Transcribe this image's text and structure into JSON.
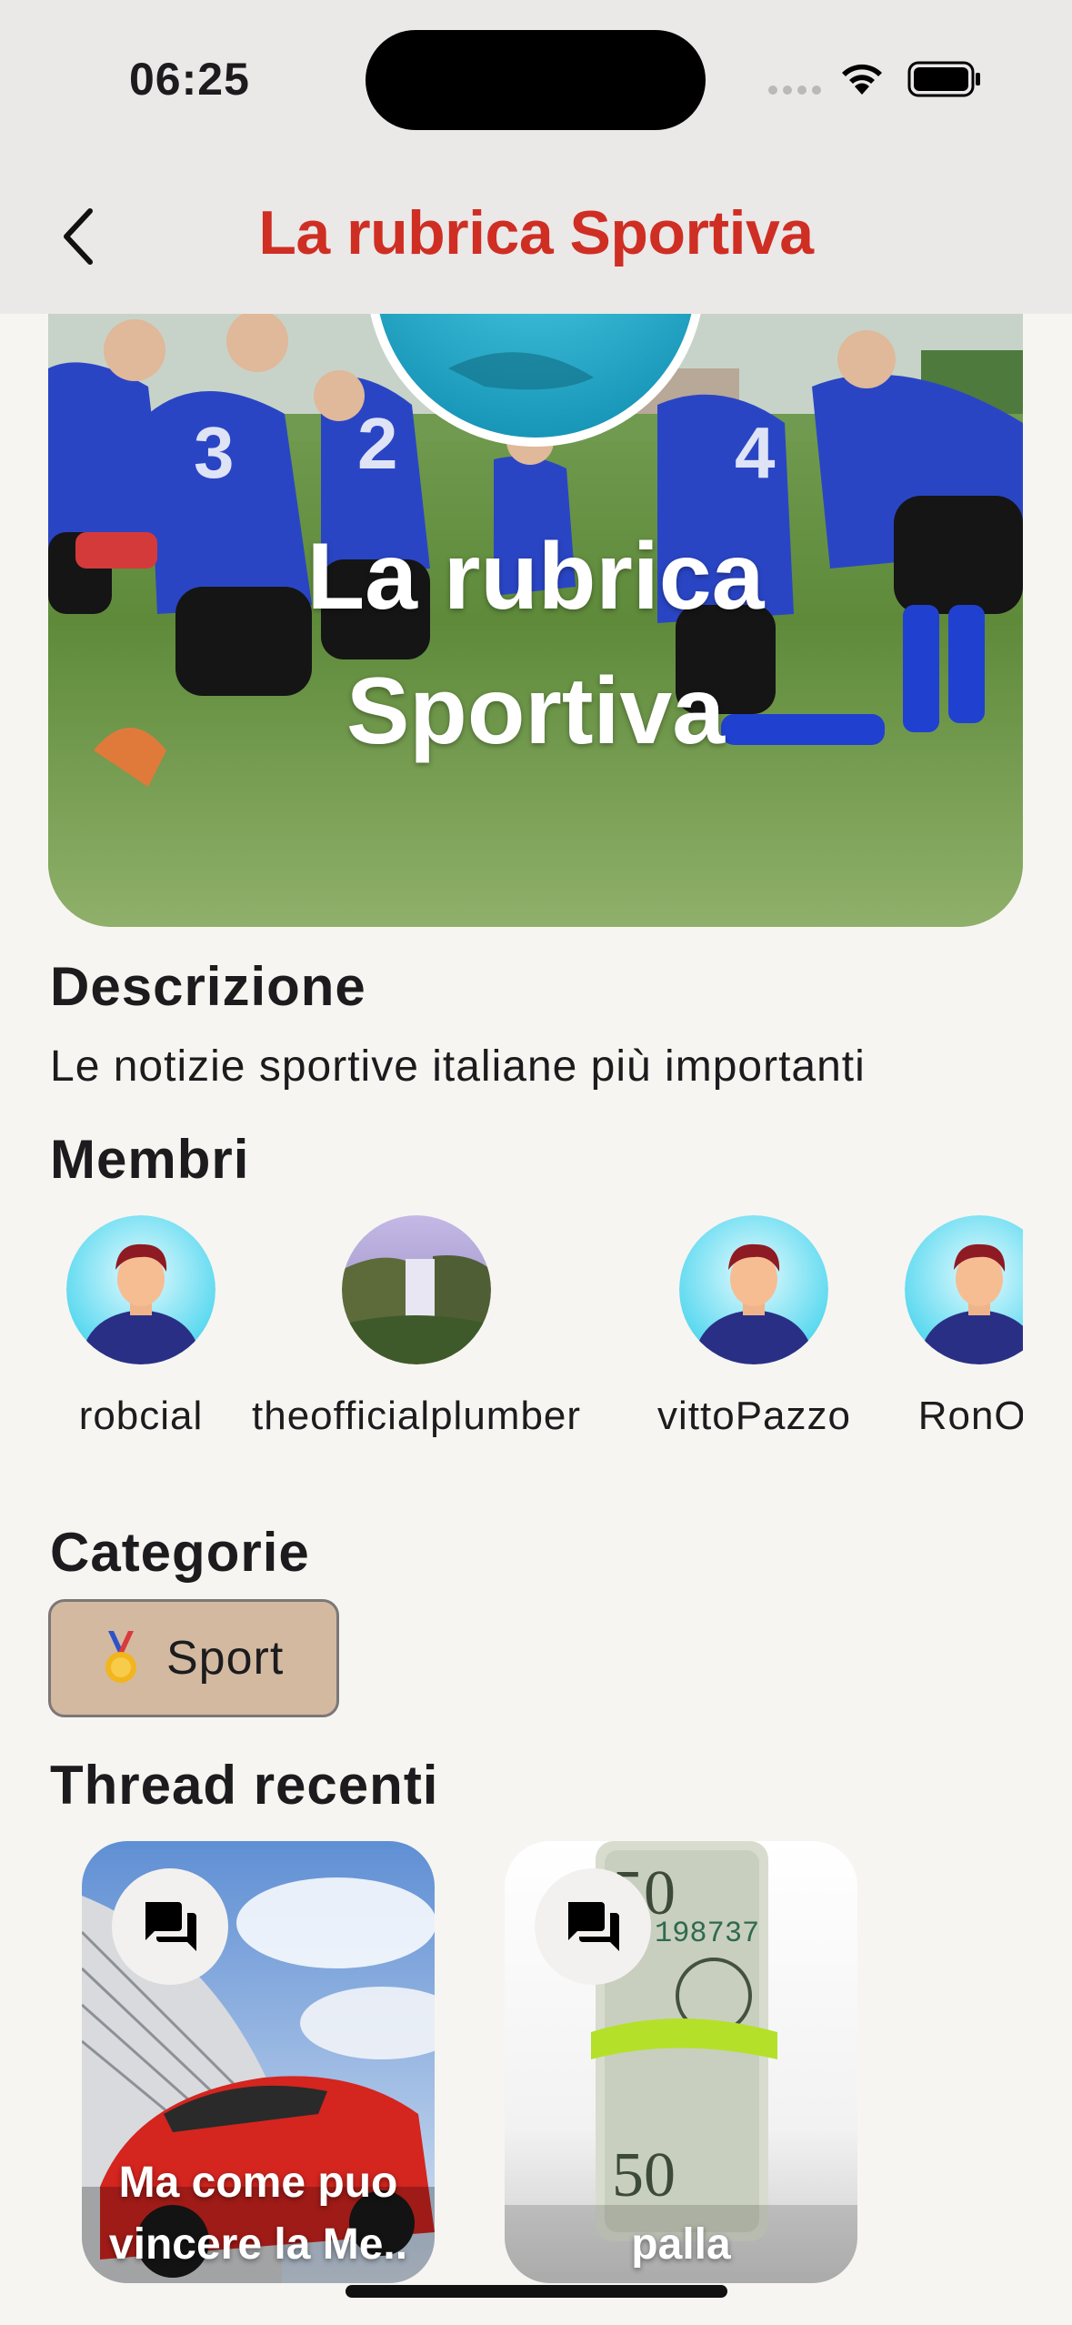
{
  "status_bar": {
    "time": "06:25"
  },
  "nav": {
    "title": "La rubrica Sportiva"
  },
  "banner": {
    "title_line1": "La rubrica",
    "title_line2": "Sportiva"
  },
  "description": {
    "heading": "Descrizione",
    "text": "Le notizie sportive italiane più importanti"
  },
  "members": {
    "heading": "Membri",
    "items": [
      {
        "name": "robcial",
        "avatar": "person-avatar"
      },
      {
        "name": "theofficialplumber",
        "avatar": "waterfall-photo"
      },
      {
        "name": "vittoPazzo",
        "avatar": "person-avatar"
      },
      {
        "name": "RonOr",
        "avatar": "person-avatar"
      }
    ]
  },
  "categories": {
    "heading": "Categorie",
    "items": [
      {
        "icon": "medal-icon",
        "label": "Sport"
      }
    ]
  },
  "threads": {
    "heading": "Thread recenti",
    "items": [
      {
        "title": "Ma come puo\nvincere la Me..",
        "icon": "chat-bubbles-icon"
      },
      {
        "title": "palla",
        "icon": "chat-bubbles-icon"
      }
    ]
  },
  "colors": {
    "accent": "#cf2e23",
    "background": "#f7f5f1",
    "nav_background": "#ebe8e8",
    "chip": "#d3b9a0"
  }
}
